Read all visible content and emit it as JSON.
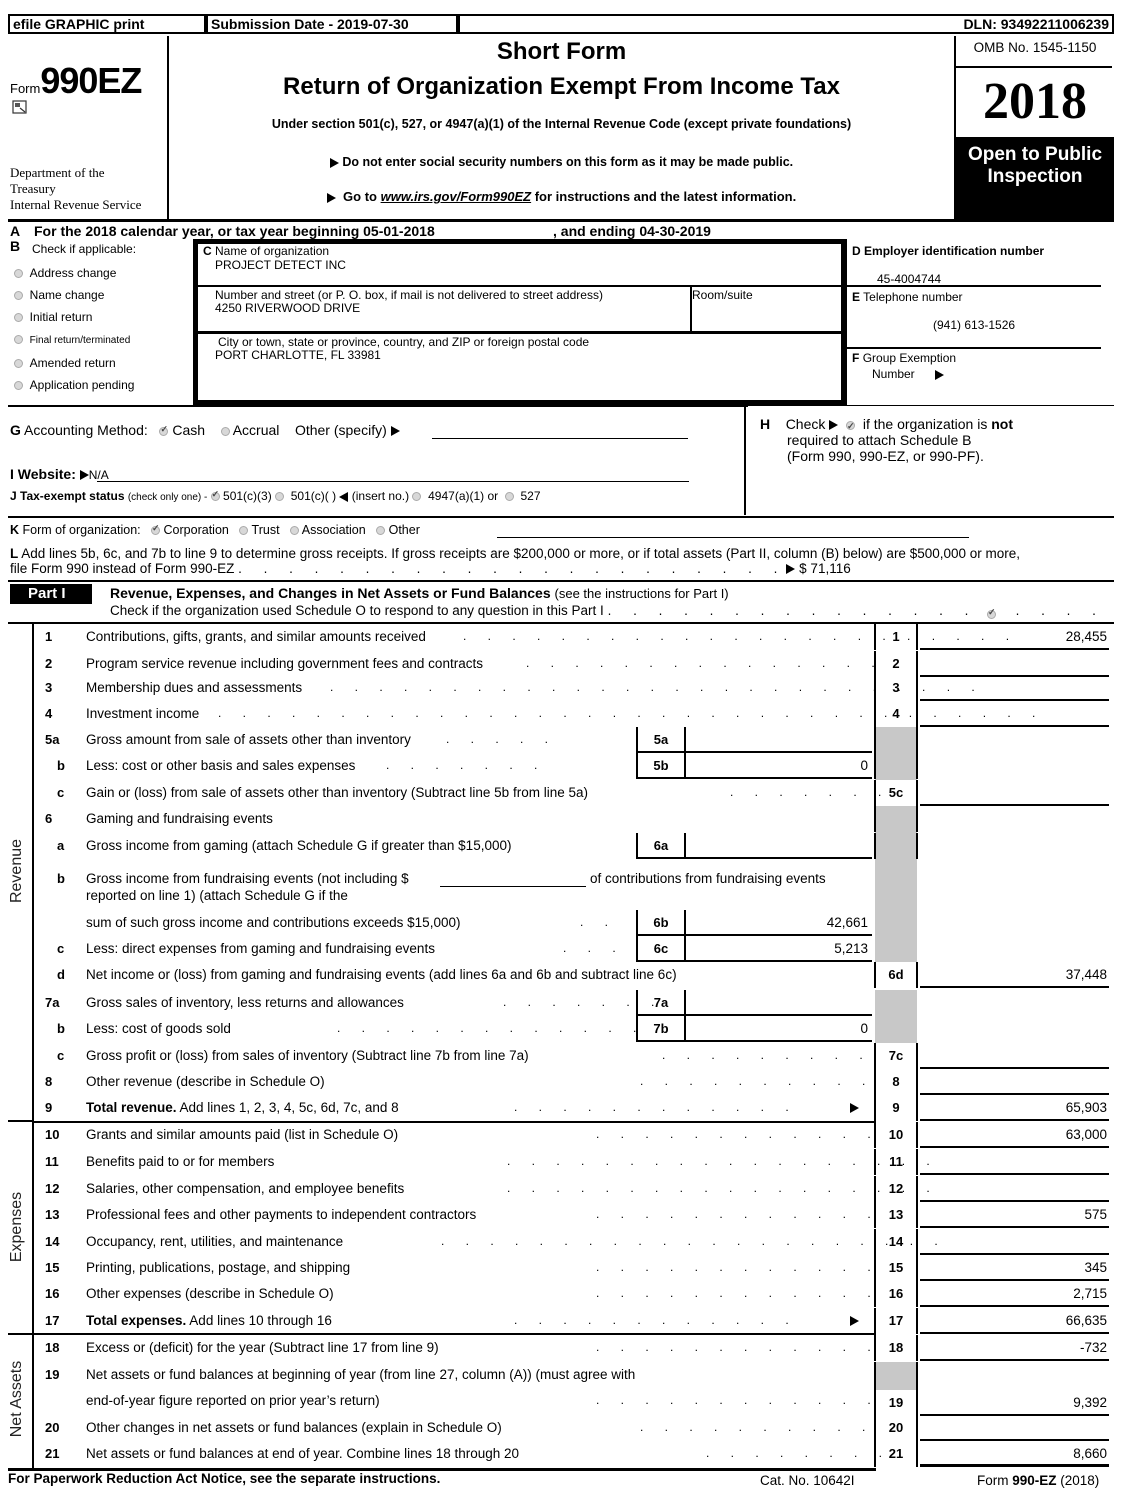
{
  "topbar": {
    "efile": "efile GRAPHIC print",
    "submission": "Submission Date - 2019-07-30",
    "dln": "DLN: 93492211006239"
  },
  "header": {
    "form_prefix": "Form",
    "form_number": "990EZ",
    "dept_line1": "Department of the",
    "dept_line2": "Treasury",
    "dept_line3": "Internal Revenue Service",
    "title1": "Short Form",
    "title2": "Return of Organization Exempt From Income Tax",
    "subtitle": "Under section 501(c), 527, or 4947(a)(1) of the Internal Revenue Code (except private foundations)",
    "notice1": "Do not enter social security numbers on this form as it may be made public.",
    "notice2_pre": "Go to ",
    "notice2_link": "www.irs.gov/Form990EZ",
    "notice2_post": " for instructions and the latest information.",
    "omb": "OMB No. 1545-1150",
    "year": "2018",
    "open_public": "Open to Public Inspection"
  },
  "lineA": {
    "label": "A",
    "text": "For the 2018 calendar year, or tax year beginning 05-01-2018",
    "ending": ", and ending 04-30-2019"
  },
  "sectionB": {
    "label": "B",
    "title": "Check if applicable:",
    "items": [
      {
        "label": "Address change",
        "checked": false
      },
      {
        "label": "Name change",
        "checked": false
      },
      {
        "label": "Initial return",
        "checked": false
      },
      {
        "label": "Final return/terminated",
        "checked": false
      },
      {
        "label": "Amended return",
        "checked": false
      },
      {
        "label": "Application pending",
        "checked": false
      }
    ]
  },
  "sectionC": {
    "name_label_letter": "C",
    "name_label": "Name of organization",
    "name_value": "PROJECT DETECT INC",
    "street_label": "Number and street (or P. O. box, if mail is not delivered to street address)",
    "street_value": "4250 RIVERWOOD DRIVE",
    "room_label": "Room/suite",
    "room_value": "",
    "city_label": "City or town, state or province, country, and ZIP or foreign postal code",
    "city_value": "PORT CHARLOTTE, FL   33981"
  },
  "sectionD": {
    "label_letter": "D",
    "label": "Employer identification number",
    "value": "45-4004744"
  },
  "sectionE": {
    "label_letter": "E",
    "label": "Telephone number",
    "value": "(941) 613-1526"
  },
  "sectionF": {
    "label_letter": "F",
    "label": "Group Exemption",
    "label2": "Number",
    "value": ""
  },
  "sectionG": {
    "letter": "G",
    "label": "Accounting Method:",
    "options": [
      {
        "label": "Cash",
        "checked": true
      },
      {
        "label": "Accrual",
        "checked": false
      }
    ],
    "other_label": "Other (specify)",
    "other_value": ""
  },
  "sectionH": {
    "letter": "H",
    "check_label": "Check",
    "checked": true,
    "text1": "if the organization is ",
    "text1_bold": "not",
    "text2": "required to attach Schedule B",
    "text3": "(Form 990, 990-EZ, or 990-PF)."
  },
  "sectionI": {
    "label": "I Website:",
    "value": "N/A"
  },
  "sectionJ": {
    "label": "J Tax-exempt status",
    "note": "(check only one) -",
    "options": [
      {
        "label": "501(c)(3)",
        "checked": true
      },
      {
        "label": "501(c)(   )",
        "checked": false
      },
      {
        "label": "4947(a)(1) or",
        "checked": false
      },
      {
        "label": "527",
        "checked": false
      }
    ],
    "insert_label": "(insert no.)"
  },
  "sectionK": {
    "letter": "K",
    "label": "Form of organization:",
    "options": [
      {
        "label": "Corporation",
        "checked": true
      },
      {
        "label": "Trust",
        "checked": false
      },
      {
        "label": "Association",
        "checked": false
      },
      {
        "label": "Other",
        "checked": false
      }
    ]
  },
  "sectionL": {
    "letter": "L",
    "text1": "Add lines 5b, 6c, and 7b to line 9 to determine gross receipts. If gross receipts are $200,000 or more, or if total assets (Part II, column (B) below) are $500,000 or more,",
    "text2": "file Form 990 instead of Form 990-EZ",
    "value": "$ 71,116"
  },
  "part1": {
    "tag": "Part I",
    "title": "Revenue, Expenses, and Changes in Net Assets or Fund Balances",
    "title_note": "(see the instructions for Part I)",
    "schedule_o_text": "Check if the organization used Schedule O to respond to any question in this Part I",
    "schedule_o_checked": true,
    "side_labels": {
      "revenue": "Revenue",
      "expenses": "Expenses",
      "net_assets": "Net Assets"
    },
    "lines": {
      "l1": {
        "num": "1",
        "desc": "Contributions, gifts, grants, and similar amounts received",
        "box": "1",
        "amount": "28,455"
      },
      "l2": {
        "num": "2",
        "desc": "Program service revenue including government fees and contracts",
        "box": "2",
        "amount": ""
      },
      "l3": {
        "num": "3",
        "desc": "Membership dues and assessments",
        "box": "3",
        "amount": ""
      },
      "l4": {
        "num": "4",
        "desc": "Investment income",
        "box": "4",
        "amount": ""
      },
      "l5a": {
        "num": "5a",
        "desc": "Gross amount from sale of assets other than inventory",
        "inbox": "5a",
        "inamount": ""
      },
      "l5b": {
        "num": "b",
        "desc": "Less: cost or other basis and sales expenses",
        "inbox": "5b",
        "inamount": "0"
      },
      "l5c": {
        "num": "c",
        "desc": "Gain or (loss) from sale of assets other than inventory (Subtract line 5b from line 5a)",
        "box": "5c",
        "amount": ""
      },
      "l6": {
        "num": "6",
        "desc": "Gaming and fundraising events"
      },
      "l6a": {
        "num": "a",
        "desc": "Gross income from gaming (attach Schedule G if greater than $15,000)",
        "inbox": "6a",
        "inamount": ""
      },
      "l6b": {
        "num": "b",
        "desc": "Gross income from fundraising events (not including $",
        "desc_b": "of contributions from fundraising events",
        "desc2": "reported on line 1) (attach Schedule G if the",
        "desc3": "sum of such gross income and contributions exceeds $15,000)",
        "inbox": "6b",
        "inamount": "42,661"
      },
      "l6c": {
        "num": "c",
        "desc": "Less: direct expenses from gaming and fundraising events",
        "inbox": "6c",
        "inamount": "5,213"
      },
      "l6d": {
        "num": "d",
        "desc": "Net income or (loss) from gaming and fundraising events (add lines 6a and 6b and subtract line 6c)",
        "box": "6d",
        "amount": "37,448"
      },
      "l7a": {
        "num": "7a",
        "desc": "Gross sales of inventory, less returns and allowances",
        "inbox": "7a",
        "inamount": ""
      },
      "l7b": {
        "num": "b",
        "desc": "Less: cost of goods sold",
        "inbox": "7b",
        "inamount": "0"
      },
      "l7c": {
        "num": "c",
        "desc": "Gross profit or (loss) from sales of inventory (Subtract line 7b from line 7a)",
        "box": "7c",
        "amount": ""
      },
      "l8": {
        "num": "8",
        "desc": "Other revenue (describe in Schedule O)",
        "box": "8",
        "amount": ""
      },
      "l9": {
        "num": "9",
        "desc_bold": "Total revenue.",
        "desc": " Add lines 1, 2, 3, 4, 5c, 6d, 7c, and 8",
        "box": "9",
        "amount": "65,903"
      },
      "l10": {
        "num": "10",
        "desc": "Grants and similar amounts paid (list in Schedule O)",
        "box": "10",
        "amount": "63,000"
      },
      "l11": {
        "num": "11",
        "desc": "Benefits paid to or for members",
        "box": "11",
        "amount": ""
      },
      "l12": {
        "num": "12",
        "desc": "Salaries, other compensation, and employee benefits",
        "box": "12",
        "amount": ""
      },
      "l13": {
        "num": "13",
        "desc": "Professional fees and other payments to independent contractors",
        "box": "13",
        "amount": "575"
      },
      "l14": {
        "num": "14",
        "desc": "Occupancy, rent, utilities, and maintenance",
        "box": "14",
        "amount": ""
      },
      "l15": {
        "num": "15",
        "desc": "Printing, publications, postage, and shipping",
        "box": "15",
        "amount": "345"
      },
      "l16": {
        "num": "16",
        "desc": "Other expenses (describe in Schedule O)",
        "box": "16",
        "amount": "2,715"
      },
      "l17": {
        "num": "17",
        "desc_bold": "Total expenses.",
        "desc": " Add lines 10 through 16",
        "box": "17",
        "amount": "66,635"
      },
      "l18": {
        "num": "18",
        "desc": "Excess or (deficit) for the year (Subtract line 17 from line 9)",
        "box": "18",
        "amount": "-732"
      },
      "l19": {
        "num": "19",
        "desc": "Net assets or fund balances at beginning of year (from line 27, column (A)) (must agree with",
        "desc2": "end-of-year figure reported on prior year’s return)",
        "box": "19",
        "amount": "9,392"
      },
      "l20": {
        "num": "20",
        "desc": "Other changes in net assets or fund balances (explain in Schedule O)",
        "box": "20",
        "amount": ""
      },
      "l21": {
        "num": "21",
        "desc": "Net assets or fund balances at end of year. Combine lines 18 through 20",
        "box": "21",
        "amount": "8,660"
      }
    }
  },
  "footer": {
    "paperwork": "For Paperwork Reduction Act Notice, see the separate instructions.",
    "cat_no": "Cat. No. 10642I",
    "form_pre": "Form ",
    "form_bold": "990-EZ",
    "form_post": " (2018)"
  }
}
